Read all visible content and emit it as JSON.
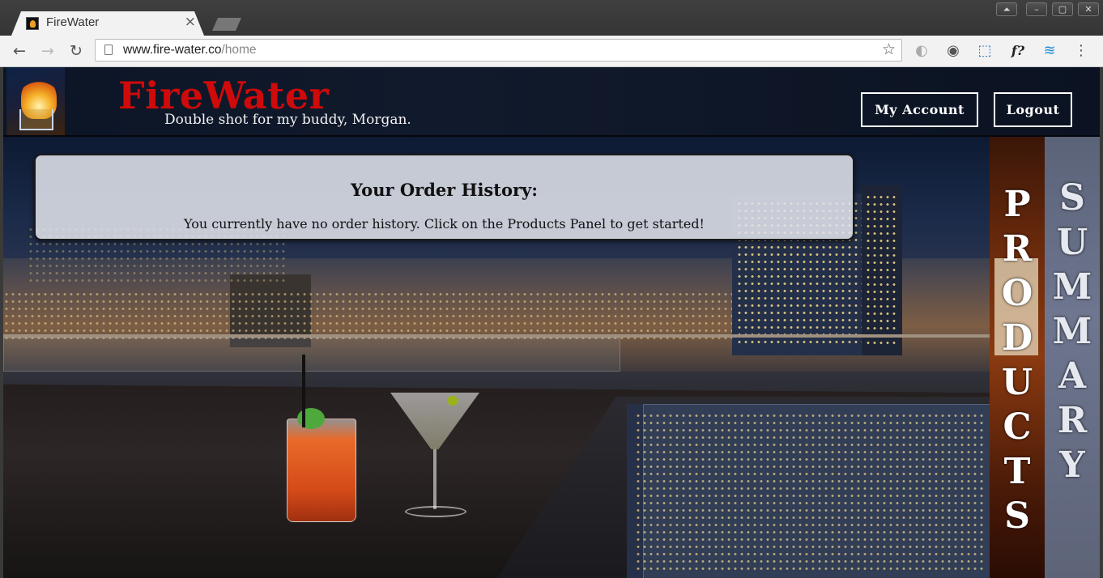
{
  "browser": {
    "tab_title": "FireWater",
    "tab_close": "×",
    "window_controls": [
      "⏶",
      "–",
      "▢",
      "✕"
    ],
    "url_host": "www.fire-water.co",
    "url_path": "/home",
    "nav": {
      "back": "←",
      "forward": "→",
      "reload": "↻"
    },
    "star": "☆",
    "extensions": [
      {
        "name": "eye-extension-icon",
        "glyph": "◐"
      },
      {
        "name": "record-extension-icon",
        "glyph": "◉"
      },
      {
        "name": "screenshot-extension-icon",
        "glyph": "⬚"
      },
      {
        "name": "font-extension-icon",
        "glyph": "f?"
      },
      {
        "name": "wave-extension-icon",
        "glyph": "≋"
      },
      {
        "name": "menu-icon",
        "glyph": "⋮"
      }
    ]
  },
  "site": {
    "brand": "FireWater",
    "tagline": "Double shot for my buddy, Morgan.",
    "my_account_label": "My Account",
    "logout_label": "Logout"
  },
  "order_history": {
    "title": "Your Order History:",
    "message": "You currently have no order history. Click on the Products Panel to get started!"
  },
  "panels": {
    "products": [
      "P",
      "R",
      "O",
      "D",
      "U",
      "C",
      "T",
      "S"
    ],
    "summary": [
      "S",
      "U",
      "M",
      "M",
      "A",
      "R",
      "Y"
    ]
  },
  "colors": {
    "brand_red": "#cf0a0a",
    "header_bg": "#0c1526"
  }
}
